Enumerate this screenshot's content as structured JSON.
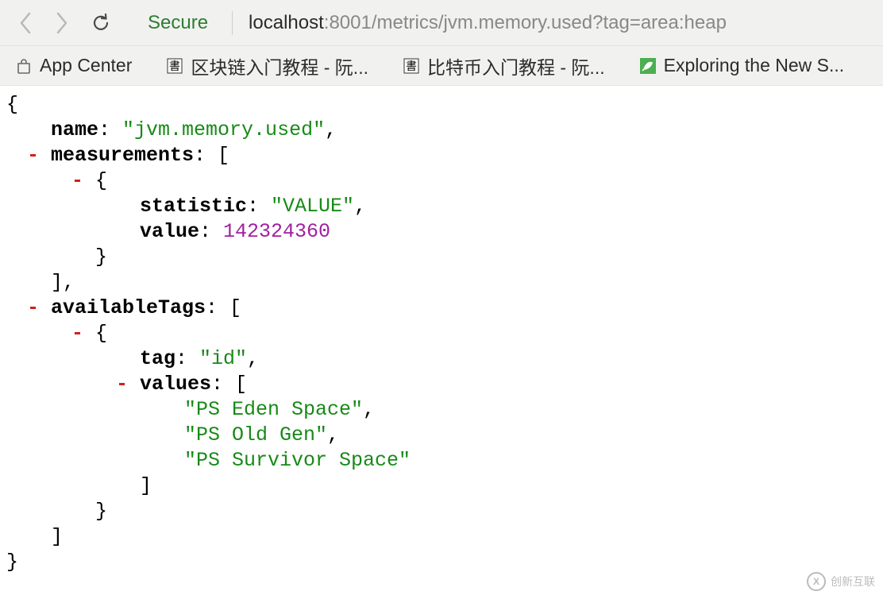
{
  "toolbar": {
    "secure_label": "Secure",
    "url_host": "localhost",
    "url_rest": ":8001/metrics/jvm.memory.used?tag=area:heap"
  },
  "bookmarks": [
    {
      "label": "App Center",
      "icon": "bag"
    },
    {
      "label": "区块链入门教程 - 阮...",
      "icon": "book"
    },
    {
      "label": "比特币入门教程 - 阮...",
      "icon": "book"
    },
    {
      "label": "Exploring the New S...",
      "icon": "leaf"
    }
  ],
  "json_view": {
    "name": {
      "key": "name",
      "value": "\"jvm.memory.used\""
    },
    "measurements_key": "measurements",
    "measurements": [
      {
        "statistic": {
          "key": "statistic",
          "value": "\"VALUE\""
        },
        "value": {
          "key": "value",
          "num": "142324360"
        }
      }
    ],
    "availableTags_key": "availableTags",
    "availableTags": [
      {
        "tag": {
          "key": "tag",
          "value": "\"id\""
        },
        "values_key": "values",
        "values": [
          "\"PS Eden Space\"",
          "\"PS Old Gen\"",
          "\"PS Survivor Space\""
        ]
      }
    ]
  },
  "watermark": "创新互联"
}
